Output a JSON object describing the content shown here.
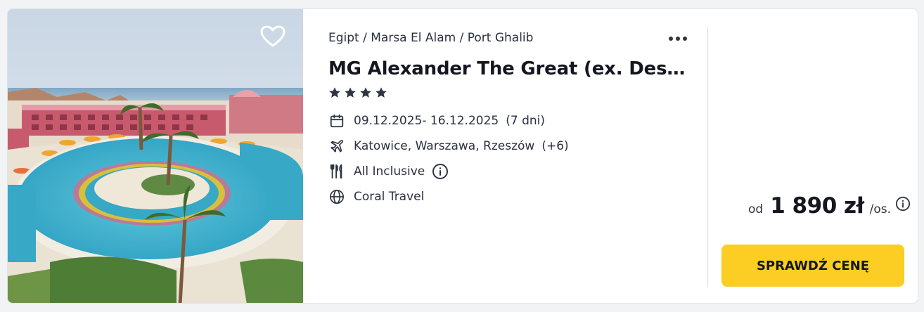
{
  "offer": {
    "breadcrumb": "Egipt / Marsa El Alam / Port Ghalib",
    "title": "MG Alexander The Great (ex. Dessole Royal Rihana Resort)",
    "stars": 4,
    "dates": "09.12.2025- 16.12.2025",
    "duration": "(7 dni)",
    "departures": "Katowice, Warszawa, Rzeszów",
    "departures_more": "(+6)",
    "board": "All Inclusive",
    "operator": "Coral Travel"
  },
  "price": {
    "prefix": "od",
    "amount": "1 890 zł",
    "suffix": "/os."
  },
  "cta": {
    "label": "SPRAWDŹ CENĘ"
  },
  "colors": {
    "cta": "#fccd22",
    "text": "#14171f",
    "icon": "#2f3441"
  },
  "icons": [
    "heart-icon",
    "more-icon",
    "star-icon",
    "calendar-icon",
    "plane-icon",
    "cutlery-icon",
    "info-icon",
    "globe-icon"
  ]
}
